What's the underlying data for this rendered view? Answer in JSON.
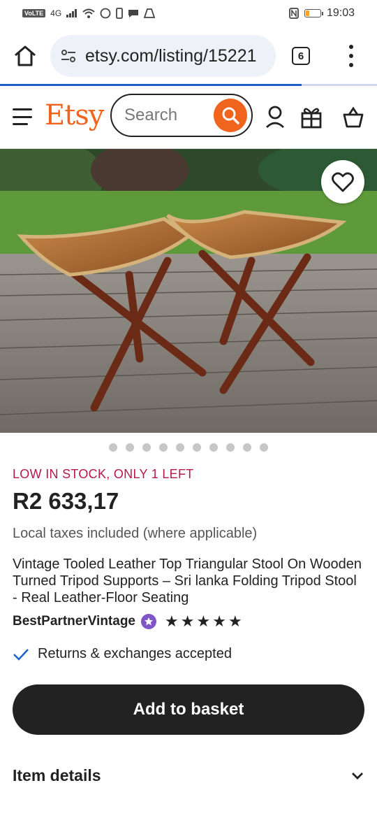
{
  "status_bar": {
    "time": "19:03",
    "network": "VoLTE",
    "signal_label": "4G"
  },
  "browser": {
    "url": "etsy.com/listing/15221",
    "tab_count": "6"
  },
  "etsy": {
    "logo": "Etsy",
    "search_placeholder": "Search"
  },
  "gallery": {
    "image_count": 10,
    "active_index": 0
  },
  "product": {
    "stock_notice": "LOW IN STOCK, ONLY 1 LEFT",
    "price": "R2 633,17",
    "tax_note": "Local taxes included (where applicable)",
    "title": "Vintage Tooled Leather Top Triangular Stool On Wooden Turned Tripod Supports – Sri lanka Folding Tripod Stool - Real Leather-Floor Seating",
    "seller": "BestPartnerVintage",
    "rating": 5,
    "returns": "Returns & exchanges accepted",
    "add_to_basket": "Add to basket",
    "item_details": "Item details"
  },
  "colors": {
    "accent": "#f1641e",
    "stock": "#b3194c",
    "badge": "#7f55c7",
    "check": "#1a63c4"
  }
}
